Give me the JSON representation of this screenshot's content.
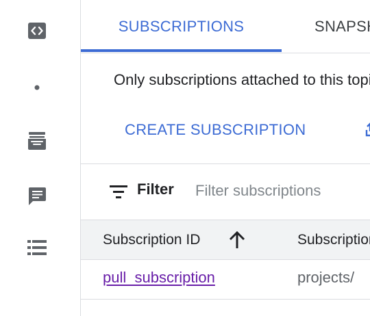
{
  "rail": {
    "icons": [
      "code-icon",
      "dot-icon",
      "inbox-icon",
      "comment-icon",
      "list-icon"
    ]
  },
  "tabs": [
    {
      "label": "SUBSCRIPTIONS",
      "active": true
    },
    {
      "label": "SNAPSHOTS",
      "active": false
    }
  ],
  "info_text": "Only subscriptions attached to this topic are shown",
  "toolbar": {
    "create_label": "CREATE SUBSCRIPTION"
  },
  "filter": {
    "label": "Filter",
    "placeholder": "Filter subscriptions"
  },
  "table": {
    "columns": [
      "Subscription ID",
      "Subscription name"
    ],
    "sort": "ascending",
    "rows": [
      {
        "id": "pull_subscription",
        "name": "projects/"
      }
    ]
  },
  "colors": {
    "accent": "#3c6bd4",
    "link_visited": "#681da8",
    "header_bg": "#f1f3f4",
    "icon_gray": "#5f6368"
  }
}
